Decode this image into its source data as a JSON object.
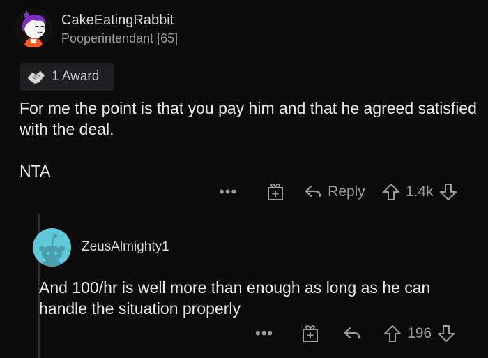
{
  "comment": {
    "username": "CakeEatingRabbit",
    "flair": "Pooperintendant [65]",
    "award_label": "1 Award",
    "body": [
      "For me the point is that you pay him and that he agreed satisfied with the deal.",
      "NTA"
    ],
    "actions": {
      "more": "•••",
      "reply_label": "Reply",
      "vote_count": "1.4k"
    }
  },
  "reply": {
    "username": "ZeusAlmighty1",
    "body": "And 100/hr is well more than enough as long as he can handle the situation properly",
    "actions": {
      "more": "•••",
      "vote_count": "196"
    }
  },
  "colors": {
    "background": "#0b0b0c",
    "text": "#e6e8ea",
    "muted": "#9a9da0",
    "reply_avatar": "#5ec8d8",
    "avatar_hair": "#7b2fbf",
    "avatar_shirt": "#ff5a1f"
  },
  "icons": [
    "handshake-award-icon",
    "more-icon",
    "gift-award-icon",
    "reply-arrow-icon",
    "upvote-icon",
    "downvote-icon",
    "snoo-avatar-icon"
  ]
}
